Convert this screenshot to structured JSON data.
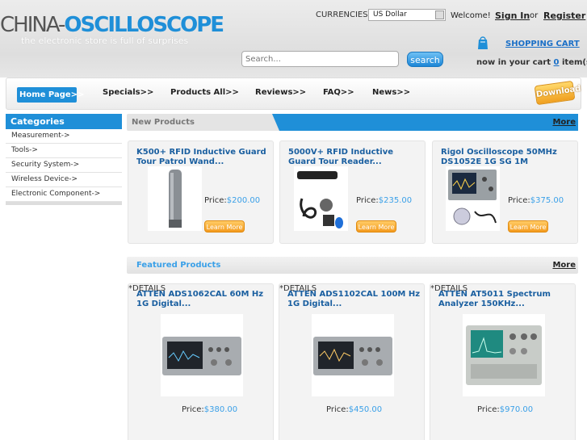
{
  "header": {
    "logo_prefix": "CHINA-",
    "logo_main": "OSCILLOSCOPE",
    "tagline": "the electronic store is full of surprises",
    "currencies_label": "CURRENCIES:",
    "currency_value": "US Dollar",
    "welcome": "Welcome!",
    "sign_in": "Sign In",
    "or": "or",
    "register": "Register",
    "shopping_cart": "SHOPPING CART",
    "cart_status_prefix": "now in your cart",
    "cart_count": "0",
    "cart_status_suffix": "item(s)",
    "search_placeholder": "Search...",
    "search_button": "search"
  },
  "nav": {
    "home": "Home Page>>",
    "items": [
      "Specials>>",
      "Products All>>",
      "Reviews>>",
      "FAQ>>",
      "News>>"
    ],
    "download_badge": "Download"
  },
  "sidebar": {
    "title": "Categories",
    "items": [
      "Measurement->",
      "Tools->",
      "Security System->",
      "Wireless Device->",
      "Electronic Component->"
    ]
  },
  "new_products": {
    "title": "New Products",
    "more": "More",
    "items": [
      {
        "title": "K500+ RFID Inductive Guard Tour Patrol Wand...",
        "price_label": "Price:",
        "price": "$200.00",
        "button": "Learn More"
      },
      {
        "title": "5000V+ RFID Inductive Guard Tour Reader...",
        "price_label": "Price:",
        "price": "$235.00",
        "button": "Learn More"
      },
      {
        "title": "Rigol Oscilloscope 50MHz DS1052E 1G SG 1M",
        "price_label": "Price:",
        "price": "$375.00",
        "button": "Learn More"
      }
    ]
  },
  "featured_products": {
    "title": "Featured Products",
    "more": "More",
    "items": [
      {
        "title": "ATTEN ADS1062CAL 60M Hz 1G Digital...",
        "price_label": "Price:",
        "price": "$380.00",
        "button": "*DETAILS"
      },
      {
        "title": "ATTEN ADS1102CAL 100M Hz 1G Digital...",
        "price_label": "Price:",
        "price": "$450.00",
        "button": "*DETAILS"
      },
      {
        "title": "ATTEN AT5011 Spectrum Analyzer 150KHz...",
        "price_label": "Price:",
        "price": "$970.00",
        "button": "*DETAILS"
      }
    ]
  },
  "colors": {
    "accent_blue": "#1f8fd8",
    "link_blue": "#1a6fc7",
    "price_blue": "#3aa0e8",
    "button_orange": "#f49a1e"
  }
}
